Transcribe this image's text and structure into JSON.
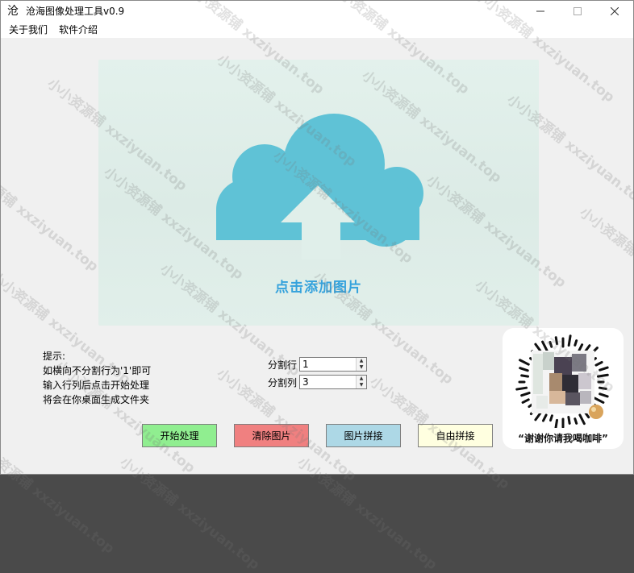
{
  "window": {
    "title": "沧海图像处理工具v0.9",
    "app_icon_glyph": "沧"
  },
  "menu": {
    "items": [
      {
        "label": "关于我们"
      },
      {
        "label": "软件介绍"
      }
    ]
  },
  "upload": {
    "label": "点击添加图片",
    "cloud_color": "#5fc2d6"
  },
  "hint": {
    "title": "提示:",
    "lines": [
      "如横向不分割行为'1'即可",
      "输入行列后点击开始处理",
      "将会在你桌面生成文件夹"
    ]
  },
  "split": {
    "rows_label": "分割行",
    "rows_value": "1",
    "cols_label": "分割列",
    "cols_value": "3"
  },
  "buttons": {
    "start": {
      "label": "开始处理",
      "color": "#90ee90"
    },
    "clear": {
      "label": "清除图片",
      "color": "#f08080"
    },
    "stitch": {
      "label": "图片拼接",
      "color": "#add8e6"
    },
    "free": {
      "label": "自由拼接",
      "color": "#ffffe0"
    }
  },
  "qr": {
    "caption": "“谢谢你请我喝咖啡”"
  },
  "watermark": {
    "text": "小小资源铺 xxziyuan.top"
  }
}
